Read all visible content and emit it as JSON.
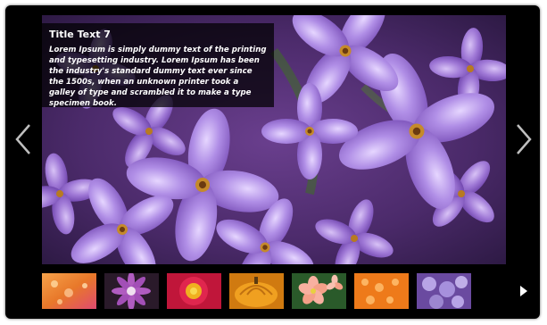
{
  "slide": {
    "title": "Title Text 7",
    "description": "Lorem Ipsum is simply dummy text of the printing and typesetting industry. Lorem Ipsum has been the industry's standard dummy text ever since the 1500s, when an unknown printer took a galley of type and scrambled it to make a type specimen book.",
    "image_subject": "purple lilac flowers"
  },
  "controls": {
    "prev_icon": "chevron-left-icon",
    "next_icon": "chevron-right-icon",
    "thumb_next_icon": "triangle-right-icon"
  },
  "thumbnails": [
    {
      "subject": "orange water drops",
      "color": "#e8782a"
    },
    {
      "subject": "purple daisy",
      "color": "#8a3fa0"
    },
    {
      "subject": "red flower",
      "color": "#d8254a"
    },
    {
      "subject": "orange pumpkin",
      "color": "#f0a020"
    },
    {
      "subject": "pink flowers",
      "color": "#f4a088"
    },
    {
      "subject": "orange water drops",
      "color": "#ee7a1a"
    },
    {
      "subject": "purple lilac",
      "color": "#9c86d0"
    }
  ],
  "colors": {
    "frame": "#000000",
    "caption_bg": "rgba(0,0,0,0.72)",
    "arrow": "#bfbfbf"
  }
}
